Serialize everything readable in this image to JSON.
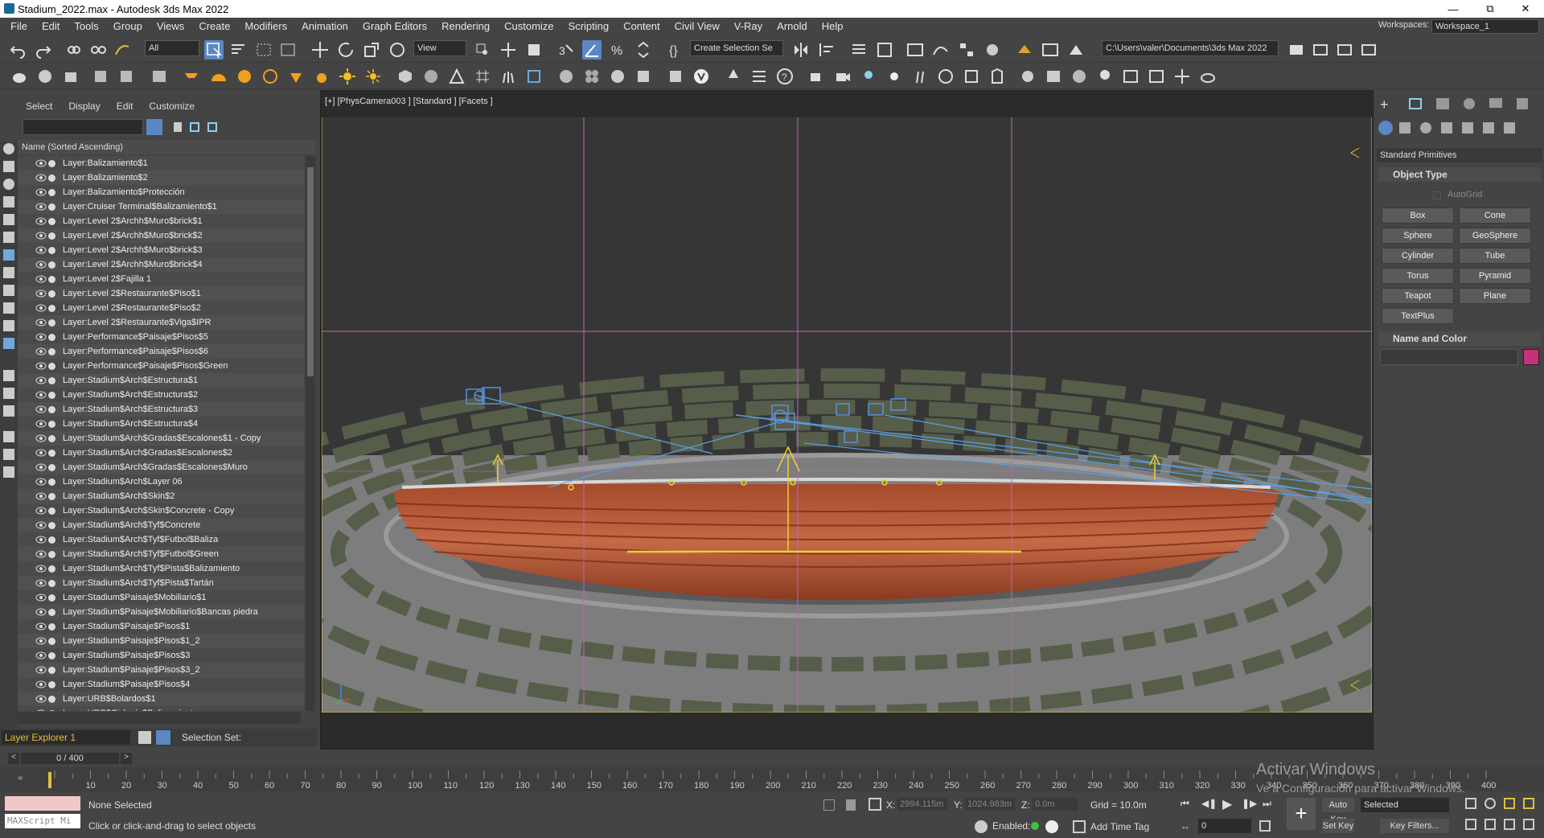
{
  "window": {
    "title": "Stadium_2022.max - Autodesk 3ds Max 2022"
  },
  "menu": [
    "File",
    "Edit",
    "Tools",
    "Group",
    "Views",
    "Create",
    "Modifiers",
    "Animation",
    "Graph Editors",
    "Rendering",
    "Customize",
    "Scripting",
    "Content",
    "Civil View",
    "V-Ray",
    "Arnold",
    "Help"
  ],
  "workspace": {
    "label": "Workspaces:",
    "value": "Workspace_1"
  },
  "toolbar": {
    "filter": "All",
    "refcoord": "View",
    "selection_set": "Create Selection Se",
    "path": "C:\\Users\\valer\\Documents\\3ds Max 2022"
  },
  "scene_explorer": {
    "menus": [
      "Select",
      "Display",
      "Edit",
      "Customize"
    ],
    "column_header": "Name (Sorted Ascending)",
    "layers": [
      "Layer:Balizamiento$1",
      "Layer:Balizamiento$2",
      "Layer:Balizamiento$Protección",
      "Layer:Cruiser Terminal$Balizamiento$1",
      "Layer:Level 2$Archh$Muro$brick$1",
      "Layer:Level 2$Archh$Muro$brick$2",
      "Layer:Level 2$Archh$Muro$brick$3",
      "Layer:Level 2$Archh$Muro$brick$4",
      "Layer:Level 2$Fajilla 1",
      "Layer:Level 2$Restaurante$Piso$1",
      "Layer:Level 2$Restaurante$Piso$2",
      "Layer:Level 2$Restaurante$Viga$IPR",
      "Layer:Performance$Paisaje$Pisos$5",
      "Layer:Performance$Paisaje$Pisos$6",
      "Layer:Performance$Paisaje$Pisos$Green",
      "Layer:Stadium$Arch$Estructura$1",
      "Layer:Stadium$Arch$Estructura$2",
      "Layer:Stadium$Arch$Estructura$3",
      "Layer:Stadium$Arch$Estructura$4",
      "Layer:Stadium$Arch$Gradas$Escalones$1 - Copy",
      "Layer:Stadium$Arch$Gradas$Escalones$2",
      "Layer:Stadium$Arch$Gradas$Escalones$Muro",
      "Layer:Stadium$Arch$Layer 06",
      "Layer:Stadium$Arch$Skin$2",
      "Layer:Stadium$Arch$Skin$Concrete - Copy",
      "Layer:Stadium$Arch$Tyf$Concrete",
      "Layer:Stadium$Arch$Tyf$Futbol$Baliza",
      "Layer:Stadium$Arch$Tyf$Futbol$Green",
      "Layer:Stadium$Arch$Tyf$Pista$Balizamiento",
      "Layer:Stadium$Arch$Tyf$Pista$Tartán",
      "Layer:Stadium$Paisaje$Mobiliario$1",
      "Layer:Stadium$Paisaje$Mobiliario$Bancas piedra",
      "Layer:Stadium$Paisaje$Pisos$1",
      "Layer:Stadium$Paisaje$Pisos$1_2",
      "Layer:Stadium$Paisaje$Pisos$3",
      "Layer:Stadium$Paisaje$Pisos$3_2",
      "Layer:Stadium$Paisaje$Pisos$4",
      "Layer:URB$Bolardos$1",
      "Layer:URB$Ciclovía$Balizamiento"
    ],
    "explorer_name": "Layer Explorer 1",
    "selection_set_label": "Selection Set:"
  },
  "frame_counter": "0 / 400",
  "viewport": {
    "label": "[+] [PhysCamera003 ] [Standard ] [Facets ]"
  },
  "command_panel": {
    "category": "Standard Primitives",
    "object_type_title": "Object Type",
    "autogrid": "AutoGrid",
    "primitives": [
      "Box",
      "Cone",
      "Sphere",
      "GeoSphere",
      "Cylinder",
      "Tube",
      "Torus",
      "Pyramid",
      "Teapot",
      "Plane",
      "TextPlus"
    ],
    "name_color_title": "Name and Color",
    "object_color": "#c8307a"
  },
  "timeline": {
    "ticks": [
      "10",
      "20",
      "30",
      "40",
      "50",
      "60",
      "70",
      "80",
      "90",
      "100",
      "110",
      "120",
      "130",
      "140",
      "150",
      "160",
      "170",
      "180",
      "190",
      "200",
      "210",
      "220",
      "230",
      "240",
      "250",
      "260",
      "270",
      "280",
      "290",
      "300",
      "310",
      "320",
      "330",
      "340",
      "350",
      "360",
      "370",
      "380",
      "390",
      "400"
    ]
  },
  "status": {
    "maxscript": "MAXScript Mi",
    "selection": "None Selected",
    "prompt": "Click or click-and-drag to select objects",
    "x_label": "X:",
    "x_val": "2994.115m",
    "y_label": "Y:",
    "y_val": "1024.983m",
    "z_label": "Z:",
    "z_val": "0.0m",
    "grid": "Grid = 10.0m",
    "enabled": "Enabled:",
    "add_time_tag": "Add Time Tag",
    "auto_key": "Auto Key",
    "set_key": "Set Key",
    "selected": "Selected",
    "key_filters": "Key Filters...",
    "frame": "0"
  },
  "watermark": {
    "line1": "Activar Windows",
    "line2": "Ve a Configuración para activar Windows."
  }
}
